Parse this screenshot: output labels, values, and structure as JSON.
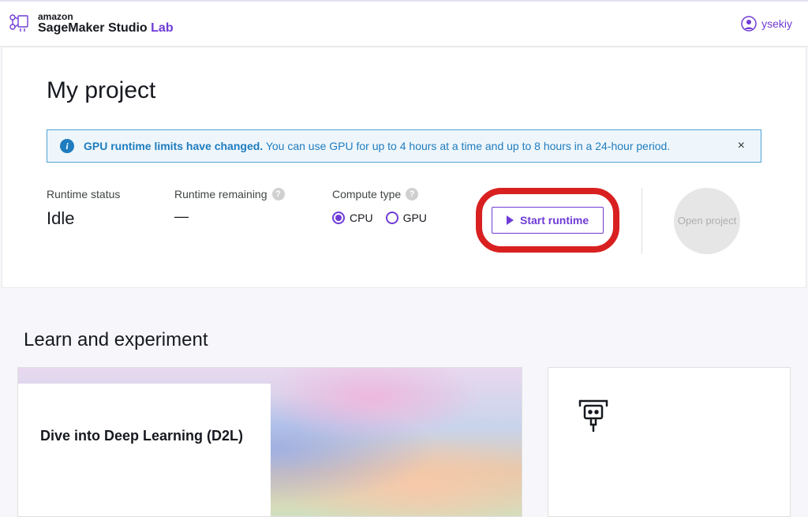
{
  "header": {
    "brand_top": "amazon",
    "brand_main": "SageMaker Studio",
    "brand_accent": "Lab",
    "username": "ysekiy"
  },
  "project": {
    "title": "My project",
    "alert": {
      "strong": "GPU runtime limits have changed.",
      "message": "You can use GPU for up to 4 hours at a time and up to 8 hours in a 24-hour period."
    },
    "status": {
      "label": "Runtime status",
      "value": "Idle"
    },
    "remaining": {
      "label": "Runtime remaining",
      "value": "—"
    },
    "compute": {
      "label": "Compute type",
      "options": {
        "cpu": "CPU",
        "gpu": "GPU"
      },
      "selected": "cpu"
    },
    "start_btn": "Start runtime",
    "open_project": "Open project"
  },
  "learn": {
    "section_title": "Learn and experiment",
    "card1_title": "Dive into Deep Learning (D2L)"
  }
}
